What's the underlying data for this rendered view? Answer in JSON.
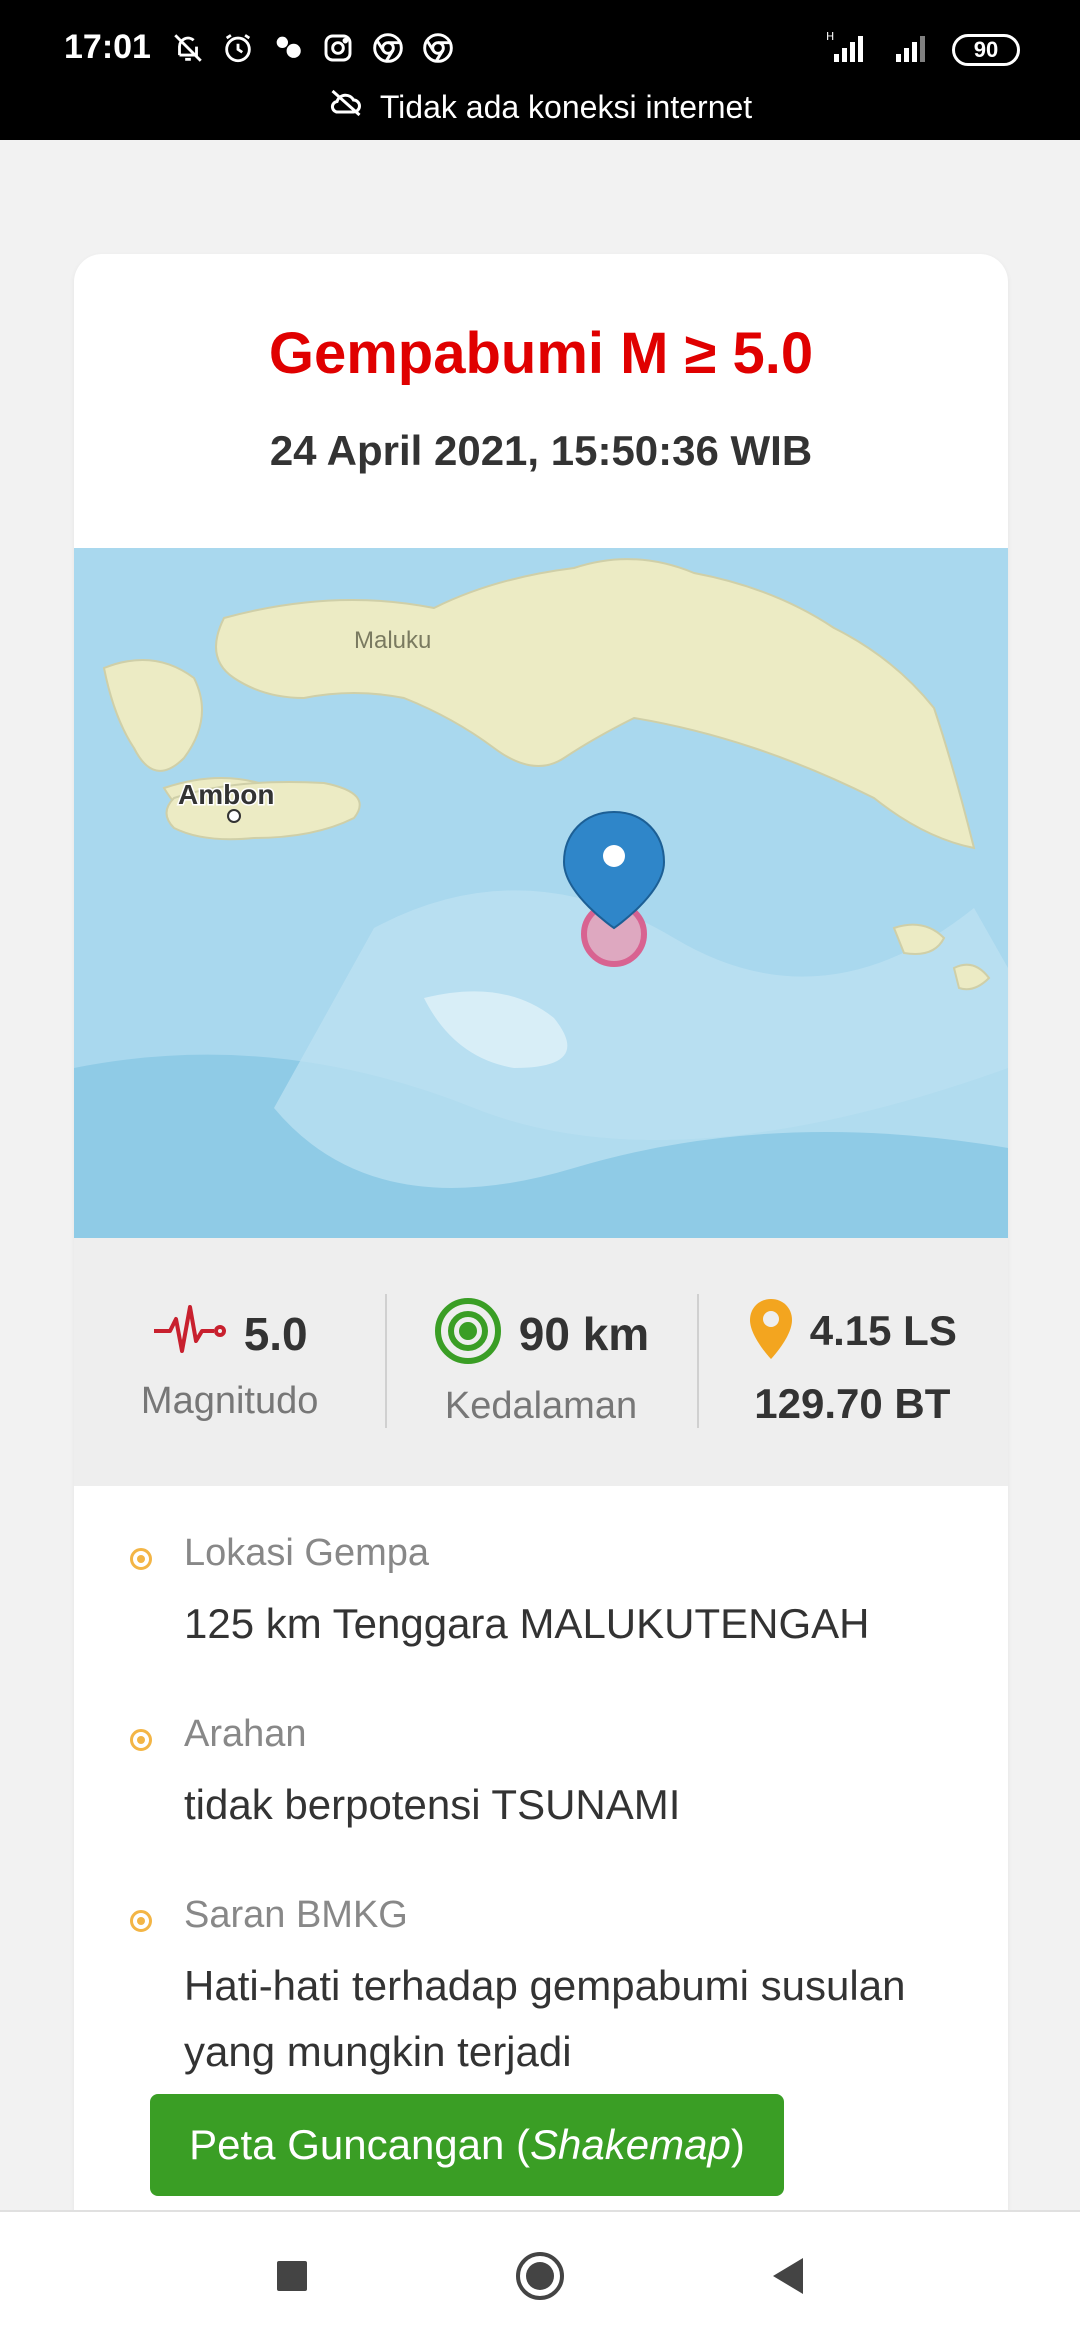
{
  "status_bar": {
    "time": "17:01",
    "battery": "90",
    "banner": "Tidak ada koneksi internet",
    "icons": [
      "bell-off-icon",
      "alarm-icon",
      "app-icon",
      "instagram-icon",
      "chrome-icon",
      "chrome-icon"
    ]
  },
  "event": {
    "title": "Gempabumi M ≥ 5.0",
    "datetime": "24 April 2021, 15:50:36 WIB"
  },
  "map": {
    "labels": [
      "Maluku",
      "Ambon"
    ]
  },
  "stats": {
    "magnitude_value": "5.0",
    "magnitude_label": "Magnitudo",
    "depth_value": "90 km",
    "depth_label": "Kedalaman",
    "lat": "4.15 LS",
    "lon": "129.70 BT"
  },
  "info": [
    {
      "label": "Lokasi Gempa",
      "value": "125 km Tenggara MALUKUTENGAH"
    },
    {
      "label": "Arahan",
      "value": "tidak berpotensi TSUNAMI"
    },
    {
      "label": "Saran BMKG",
      "value": "Hati-hati terhadap gempabumi susulan yang mungkin terjadi"
    }
  ],
  "button": {
    "prefix": "Peta Guncangan (",
    "italic": "Shakemap",
    "suffix": ")"
  },
  "colors": {
    "title": "#e00000",
    "button": "#3a9e25",
    "bullet": "#f3b545",
    "pin": "#2f86c9"
  }
}
